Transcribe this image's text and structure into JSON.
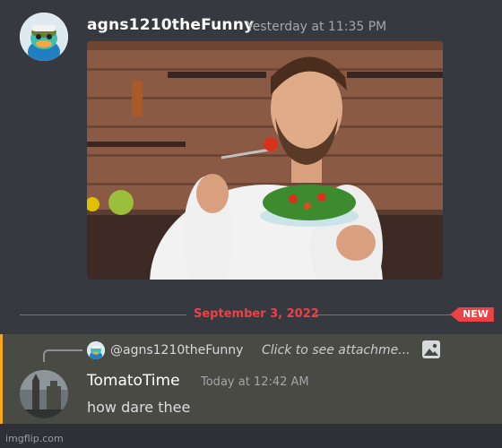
{
  "message1": {
    "username": "agns1210theFunny",
    "timestamp": "Yesterday at 11:35 PM",
    "attachment_icon": "photo-attachment"
  },
  "divider": {
    "date": "September 3, 2022",
    "new_badge": "NEW",
    "color": "#ed4245"
  },
  "message2": {
    "reply": {
      "username": "@agns1210theFunny",
      "text": "Click to see attachme...",
      "icon": "image-icon"
    },
    "username": "TomatoTime",
    "timestamp": "Today at 12:42 AM",
    "content": "how dare thee",
    "highlight_color": "#faa81a"
  },
  "footer": {
    "watermark": "imgflip.com"
  }
}
